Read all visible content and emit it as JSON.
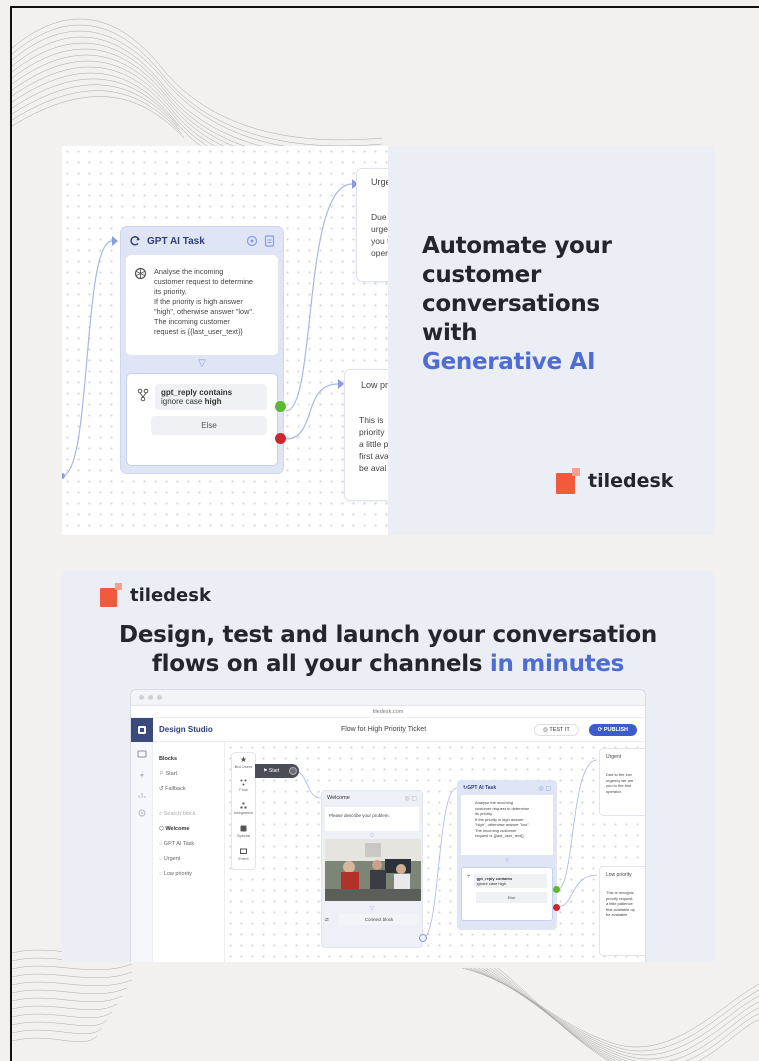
{
  "banner_top": {
    "headline_lines": [
      "Automate your",
      "customer",
      "conversations",
      "with"
    ],
    "headline_accent": "Generative AI",
    "brand_name": "tiledesk",
    "gpt_block": {
      "title": "GPT AI Task",
      "prompt": "Analyse the incoming\ncustomer request to determine\nits priority.\nIf the priority is high answer\n\"high\", otherwise answer \"low\".\nThe incoming customer\nrequest is {{last_user_text}}",
      "condition_title": "gpt_reply contains",
      "condition_prefix": "ignore case",
      "condition_value": "high",
      "else_label": "Else"
    },
    "urgent_card": {
      "title": "Urge",
      "body_lines": [
        "Due t",
        "urge",
        "you t",
        "oper"
      ]
    },
    "low_card": {
      "title": "Low pri",
      "body_lines": [
        "This is",
        "priority",
        "a little p",
        "first ava",
        "be avai"
      ]
    }
  },
  "banner_bottom": {
    "brand_name": "tiledesk",
    "title_line1": "Design, test and launch your conversation",
    "title_line2": "flows on all your channels",
    "title_accent": "in minutes",
    "browser": {
      "url": "tiledesk.com",
      "app_title": "Design Studio",
      "flow_title": "Flow for High Priority Ticket",
      "test_label": "TEST IT",
      "publish_label": "PUBLISH",
      "sidebar": {
        "blocks_heading": "Blocks",
        "items_top": [
          "Start",
          "Fallback"
        ],
        "search_placeholder": "Search block",
        "items_bottom": [
          "Welcome",
          "GPT AI Task",
          "Urgent",
          "Low priority"
        ]
      },
      "tools": [
        "Bot Users",
        "Flow",
        "Integration",
        "Special",
        "Event"
      ],
      "start_label": "Start",
      "welcome": {
        "title": "Welcome",
        "text": "Please describe your problem.",
        "connect_label": "Connect block"
      },
      "gpt": {
        "title": "GPT AI Task",
        "prompt": "Analyse the incoming\ncustomer request to determine\nits priority.\nIf the priority is high answer\n\"high\", otherwise answer \"low\".\nThe incoming customer\nrequest is {{last_user_text}}",
        "condition_title": "gpt_reply contains",
        "condition_sub": "ignore case high",
        "else_label": "Else"
      },
      "urgent": {
        "title": "Urgent",
        "body": "Due to the incr\nurgency we are\nyou to the first\noperator."
      },
      "low": {
        "title": "Low priority",
        "body": "This is recogniz\npriority request.\na little patience\nfirst available op\nbe available"
      }
    }
  },
  "colors": {
    "accent": "#4e6cd2",
    "brand_orange": "#f15a3d",
    "success": "#5cb82d",
    "danger": "#c8272d",
    "publish": "#3d5ccc"
  }
}
